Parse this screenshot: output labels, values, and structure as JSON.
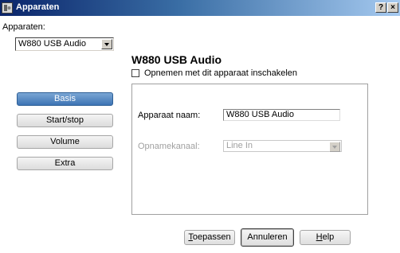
{
  "window": {
    "title": "Apparaten",
    "help_btn": "?",
    "close_btn": "×"
  },
  "devices": {
    "label": "Apparaten:",
    "selected": "W880 USB Audio"
  },
  "device": {
    "heading": "W880 USB Audio",
    "record_checkbox_label": "Opnemen met dit apparaat inschakelen",
    "record_checked": false
  },
  "nav": [
    {
      "label": "Basis",
      "active": true
    },
    {
      "label": "Start/stop",
      "active": false
    },
    {
      "label": "Volume",
      "active": false
    },
    {
      "label": "Extra",
      "active": false
    }
  ],
  "form": {
    "name_label": "Apparaat naam:",
    "name_value": "W880 USB Audio",
    "channel_label": "Opnamekanaal:",
    "channel_value": "Line In"
  },
  "buttons": {
    "apply_ul": "T",
    "apply_rest": "oepassen",
    "cancel": "Annuleren",
    "help_ul": "H",
    "help_rest": "elp"
  }
}
